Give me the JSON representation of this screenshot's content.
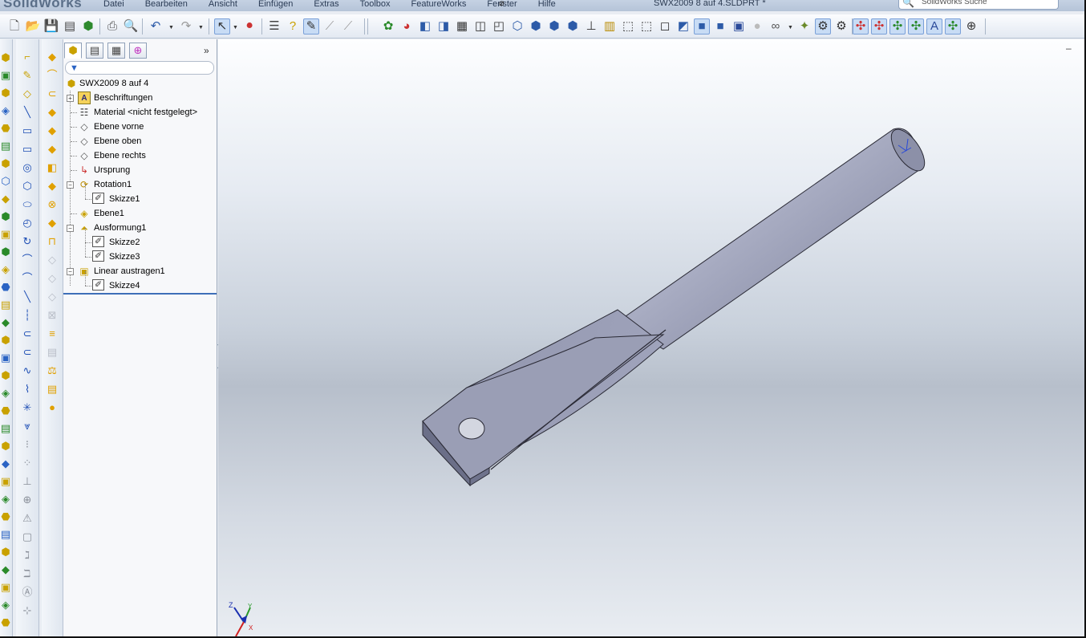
{
  "app": {
    "logo": "SolidWorks",
    "document_title": "SWX2009 8 auf 4.SLDPRT *",
    "search_placeholder": "SolidWorks Suche"
  },
  "menu": [
    "Datei",
    "Bearbeiten",
    "Ansicht",
    "Einfügen",
    "Extras",
    "Toolbox",
    "FeatureWorks",
    "Fenster",
    "Hilfe"
  ],
  "toolbar": {
    "icons": [
      "new-icon",
      "open-icon",
      "save-icon",
      "print-preview-icon",
      "rebuild-icon",
      "print-icon",
      "preview-icon",
      "undo-icon",
      "redo-icon",
      "select-icon",
      "traffic-light-icon",
      "options-icon",
      "help-icon",
      "sketch-icon",
      "smart-dimension-icon",
      "appearance-icon",
      "color-icon",
      "view-front-icon",
      "view-back-icon",
      "view-left-icon",
      "view-right-icon",
      "view-top-icon",
      "view-bottom-icon",
      "view-iso-icon",
      "view-trimetric-icon",
      "view-dimetric-icon",
      "normal-to-icon",
      "section-view-icon",
      "wireframe-icon",
      "hidden-lines-icon",
      "hidden-removed-icon",
      "shaded-edges-icon",
      "shaded-icon",
      "shadows-icon",
      "realview-icon",
      "display-type-icon",
      "hide-show-icon",
      "planes-icon",
      "axes-icon",
      "origins-icon",
      "sketches-icon",
      "points-icon",
      "curves-icon",
      "annotations-icon",
      "lights-icon",
      "cameras-icon"
    ]
  },
  "feature_manager": {
    "tabs": [
      "featuremanager-tab",
      "propertymanager-tab",
      "configurationmanager-tab",
      "dimxpert-tab"
    ],
    "root": "SWX2009 8 auf 4",
    "items": [
      {
        "label": "Beschriftungen",
        "level": 1,
        "expander": "+"
      },
      {
        "label": "Material <nicht festgelegt>",
        "level": 1,
        "expander": ""
      },
      {
        "label": "Ebene vorne",
        "level": 1,
        "expander": ""
      },
      {
        "label": "Ebene oben",
        "level": 1,
        "expander": ""
      },
      {
        "label": "Ebene rechts",
        "level": 1,
        "expander": ""
      },
      {
        "label": "Ursprung",
        "level": 1,
        "expander": ""
      },
      {
        "label": "Rotation1",
        "level": 1,
        "expander": "−"
      },
      {
        "label": "Skizze1",
        "level": 2,
        "expander": ""
      },
      {
        "label": "Ebene1",
        "level": 1,
        "expander": ""
      },
      {
        "label": "Ausformung1",
        "level": 1,
        "expander": "−"
      },
      {
        "label": "Skizze2",
        "level": 2,
        "expander": ""
      },
      {
        "label": "Skizze3",
        "level": 2,
        "expander": ""
      },
      {
        "label": "Linear austragen1",
        "level": 1,
        "expander": "−"
      },
      {
        "label": "Skizze4",
        "level": 2,
        "expander": ""
      }
    ]
  },
  "triad": {
    "x_label": "X",
    "y_label": "Y",
    "z_label": "Z"
  },
  "colors": {
    "model": "#8a8ea6",
    "accent": "#2a63c4"
  }
}
